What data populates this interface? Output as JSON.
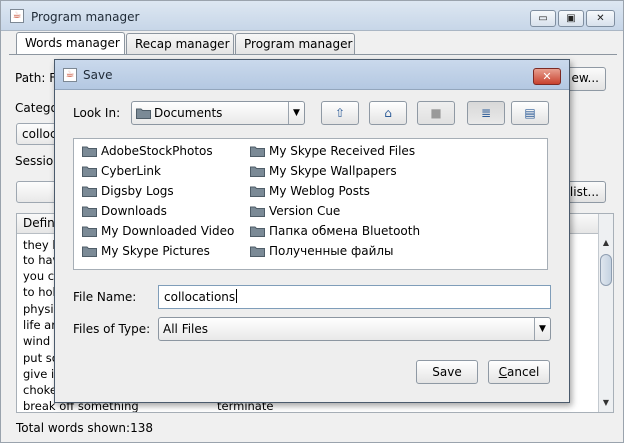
{
  "window": {
    "title": "Program manager",
    "controls": {
      "minimize": "▭",
      "maximize": "▣",
      "close": "✕"
    }
  },
  "tabs": [
    "Words manager",
    "Recap manager",
    "Program manager"
  ],
  "background": {
    "path_label": "Path: F:",
    "category_label": "Catego",
    "category_value": "colloc",
    "session_label": "Sessio",
    "view_button": "ew...",
    "list_button": "list...",
    "table_header_left": "Defini",
    "rows": [
      {
        "left": "they k",
        "right": ""
      },
      {
        "left": "to hav",
        "right": ""
      },
      {
        "left": "you ca",
        "right": ""
      },
      {
        "left": "to hol",
        "right": ""
      },
      {
        "left": "physic",
        "right": ""
      },
      {
        "left": "life ar",
        "right": ""
      },
      {
        "left": "wind u",
        "right": ""
      },
      {
        "left": "put so",
        "right": ""
      },
      {
        "left": "give in",
        "right": ""
      },
      {
        "left": "choke",
        "right": ""
      },
      {
        "left": "break off something",
        "right": "terminate"
      }
    ],
    "status": "Total words shown:138"
  },
  "dialog": {
    "title": "Save",
    "close_glyph": "✕",
    "look_in_label": "Look In:",
    "look_in_value": "Documents",
    "toolbar": [
      {
        "name": "up-one-level",
        "glyph": "⇧"
      },
      {
        "name": "home",
        "glyph": "⌂"
      },
      {
        "name": "new-folder",
        "glyph": "■"
      },
      {
        "name": "list-view",
        "glyph": "≣"
      },
      {
        "name": "details-view",
        "glyph": "▤"
      }
    ],
    "files_col1": [
      "AdobeStockPhotos",
      "CyberLink",
      "Digsby Logs",
      "Downloads",
      "My Downloaded Video",
      "My Skype Pictures"
    ],
    "files_col2": [
      "My Skype Received Files",
      "My Skype Wallpapers",
      "My Weblog Posts",
      "Version Cue",
      "Папка обмена Bluetooth",
      "Полученные файлы"
    ],
    "file_name_label": "File Name:",
    "file_name_value": "collocations",
    "files_type_label": "Files of Type:",
    "files_type_value": "All Files",
    "save_button": "Save",
    "cancel_button_c": "C",
    "cancel_button_rest": "ancel"
  }
}
